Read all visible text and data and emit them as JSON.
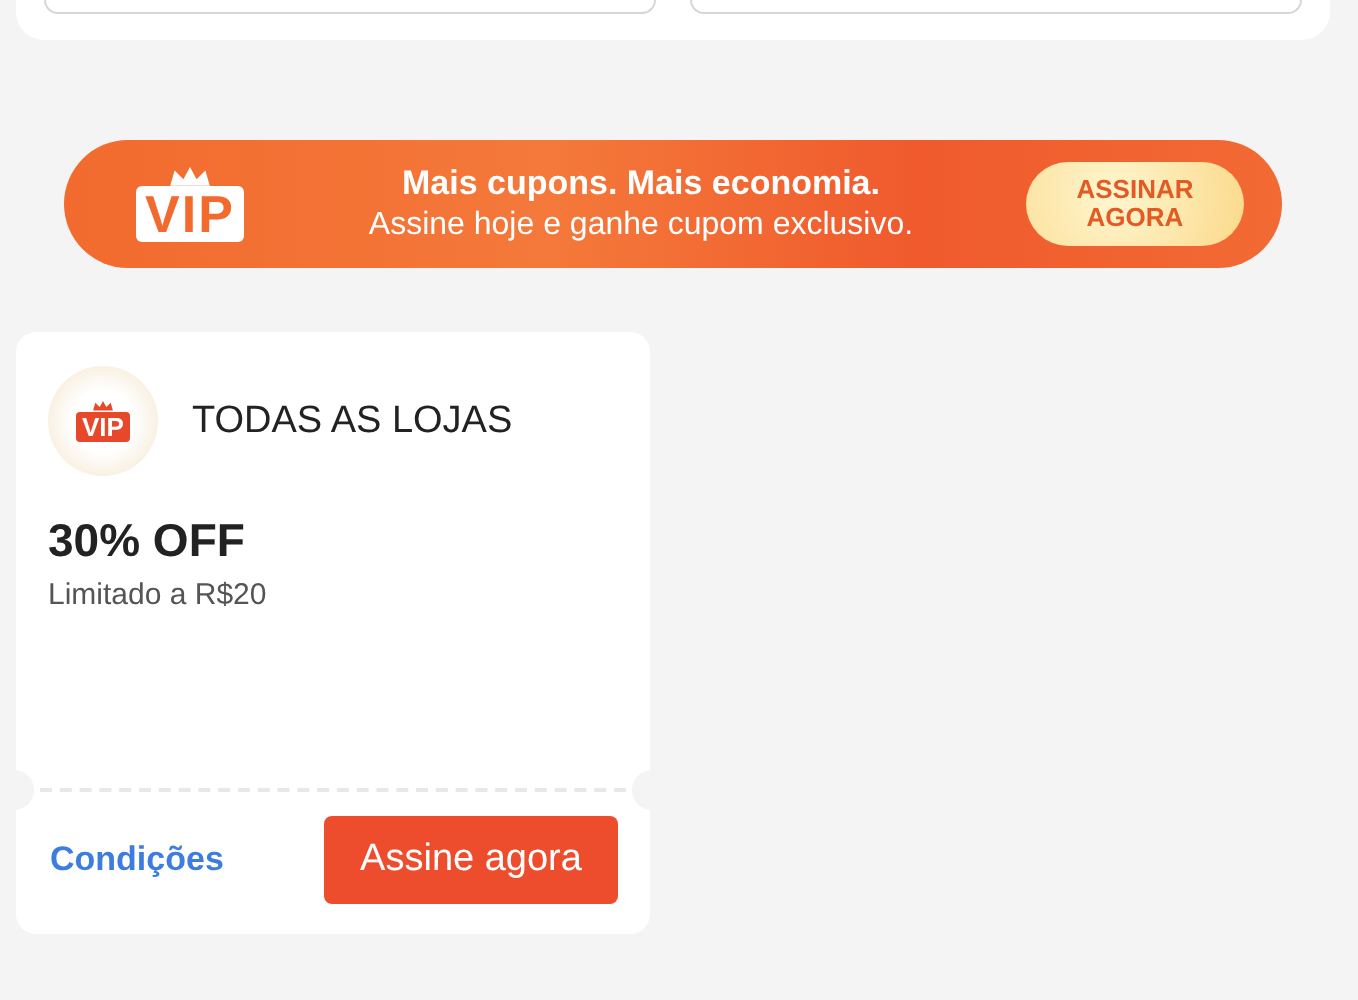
{
  "top_panel": {
    "fields": [
      {
        "kind": "outline"
      },
      {
        "kind": "outline"
      }
    ]
  },
  "vip_banner": {
    "badge": "VIP",
    "headline": "Mais cupons. Mais economia.",
    "subline": "Assine hoje e ganhe cupom exclusivo.",
    "button": "ASSINAR AGORA"
  },
  "coupons": [
    {
      "badge": "VIP",
      "store": "TODAS AS LOJAS",
      "discount": "30% OFF",
      "limit": "Limitado a R$20",
      "link": "Condições",
      "button": "Assine agora"
    }
  ]
}
